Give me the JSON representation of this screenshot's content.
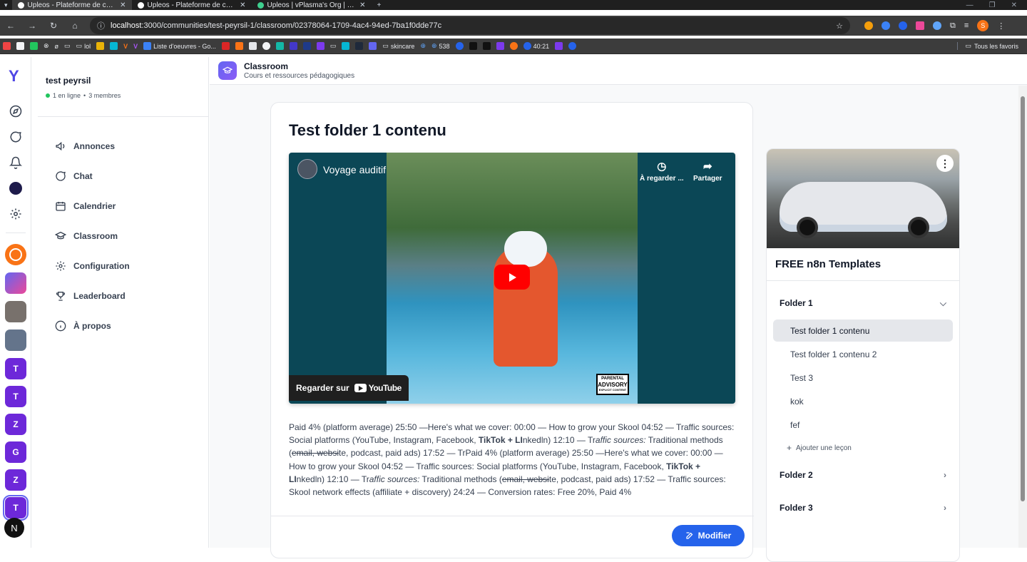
{
  "browser": {
    "tabs": [
      {
        "title": "Upleos - Plateforme de commu",
        "active": true
      },
      {
        "title": "Upleos - Plateforme de commu",
        "active": false
      },
      {
        "title": "Upleos | vPlasma's Org | Supab",
        "active": false
      }
    ],
    "url_host": "localhost",
    "url_path": ":3000/communities/test-peyrsil-1/classroom/02378064-1709-4ac4-94ed-7ba1f0dde77c",
    "bookmarks": [
      "Liste d'oeuvres - Go...",
      "skincare",
      "538",
      "40:21"
    ],
    "all_bookmarks": "Tous les favoris",
    "bookmark_lol": "lol",
    "profile_initial": "S"
  },
  "rail": {
    "logo": "Y",
    "communities": [
      {
        "initial": "T",
        "color": "#6d28d9"
      },
      {
        "initial": "T",
        "color": "#6d28d9"
      },
      {
        "initial": "Z",
        "color": "#6d28d9"
      },
      {
        "initial": "G",
        "color": "#6d28d9"
      },
      {
        "initial": "Z",
        "color": "#6d28d9"
      },
      {
        "initial": "T",
        "color": "#6d28d9"
      }
    ],
    "help_initial": "N"
  },
  "community": {
    "name": "test peyrsil",
    "online": "1 en ligne",
    "members": "3 membres"
  },
  "menu": [
    {
      "label": "Annonces",
      "icon": "megaphone-icon"
    },
    {
      "label": "Chat",
      "icon": "chat-bubble-icon"
    },
    {
      "label": "Calendrier",
      "icon": "calendar-icon"
    },
    {
      "label": "Classroom",
      "icon": "graduation-cap-icon"
    },
    {
      "label": "Configuration",
      "icon": "gear-icon"
    },
    {
      "label": "Leaderboard",
      "icon": "trophy-icon"
    },
    {
      "label": "À propos",
      "icon": "info-icon"
    }
  ],
  "header": {
    "title": "Classroom",
    "subtitle": "Cours et ressources pédagogiques"
  },
  "lesson": {
    "title": "Test folder 1 contenu",
    "video": {
      "title": "Voyage auditif",
      "watch_later": "À regarder ...",
      "share": "Partager",
      "watch_on": "Regarder sur",
      "youtube": "YouTube",
      "advisory_top": "PARENTAL",
      "advisory_mid": "ADVISORY",
      "advisory_bot": "EXPLICIT CONTENT"
    },
    "desc": {
      "p1": "Paid 4% (platform average) 25:50 —Here's what we cover: 00:00 — How to grow your Skool 04:52 — Traffic sources: Social platforms (YouTube, Instagram, Facebook, ",
      "b1": "TikTok + LI",
      "p2": "nkedln) 12:10 — Tr",
      "i1": "affic sources:",
      "p3": " Traditional methods (",
      "s1": "email, websi",
      "p4": "te, podcast, paid ads) 17:52 — TrPaid 4% (platform average) 25:50 —Here's what we cover: 00:00 — How to grow your Skool 04:52 — Traffic sources: Social platforms (YouTube, Instagram, Facebook, ",
      "b2": "TikTok + LI",
      "p5": "nkedln) 12:10 — Tr",
      "i2": "affic sources:",
      "p6": " Traditional methods (",
      "s2": "email, websi",
      "p7": "te, podcast, paid ads) 17:52 — Traffic sources: Skool network effects (affiliate + discovery) 24:24 — Conversion rates: Free 20%, Paid 4%"
    },
    "edit_label": "Modifier"
  },
  "course": {
    "title": "FREE n8n Templates",
    "folders": [
      {
        "name": "Folder 1",
        "expanded": true,
        "lessons": [
          {
            "label": "Test folder 1 contenu",
            "active": true
          },
          {
            "label": "Test folder 1 contenu 2",
            "active": false
          },
          {
            "label": "Test 3",
            "active": false
          },
          {
            "label": "kok",
            "active": false
          },
          {
            "label": "fef",
            "active": false
          }
        ],
        "add_label": "Ajouter une leçon"
      },
      {
        "name": "Folder 2",
        "expanded": false
      },
      {
        "name": "Folder 3",
        "expanded": false
      }
    ]
  },
  "colors": {
    "accent": "#2563eb",
    "brand": "#4f46e5",
    "online": "#22c55e"
  }
}
